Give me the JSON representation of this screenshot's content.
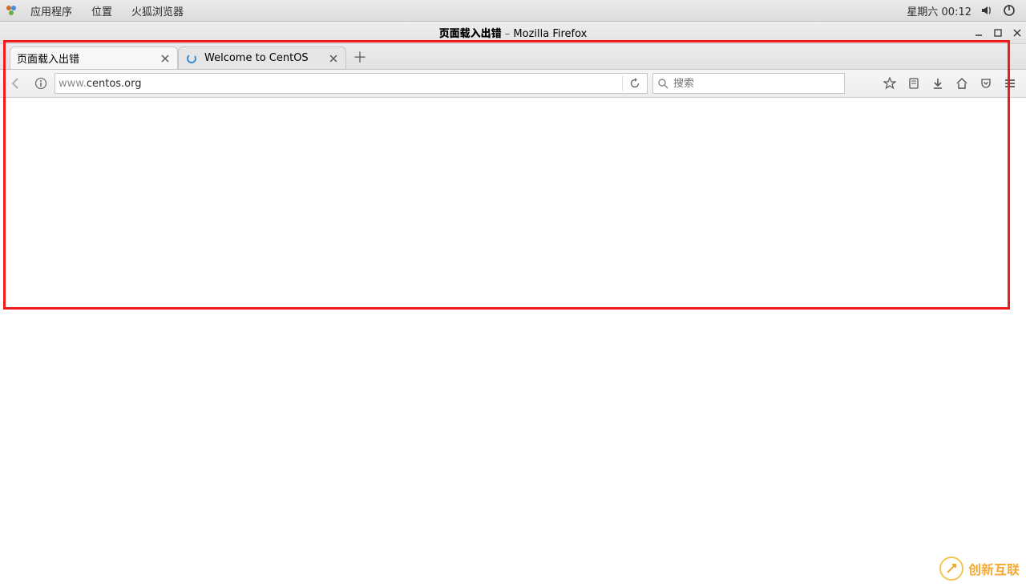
{
  "panel": {
    "menu_applications": "应用程序",
    "menu_places": "位置",
    "menu_firefox": "火狐浏览器",
    "clock": "星期六 00:12"
  },
  "window": {
    "title_page": "页面载入出错",
    "title_separator": "  –  ",
    "title_app": "Mozilla Firefox"
  },
  "tabs": [
    {
      "label": "页面载入出错",
      "active": true
    },
    {
      "label": "Welcome to CentOS",
      "active": false,
      "loading": true
    }
  ],
  "url": {
    "prefix": "www.",
    "host": "centos.org",
    "full": "www.centos.org"
  },
  "search": {
    "placeholder": "搜索"
  },
  "watermark": {
    "text": "创新互联"
  }
}
